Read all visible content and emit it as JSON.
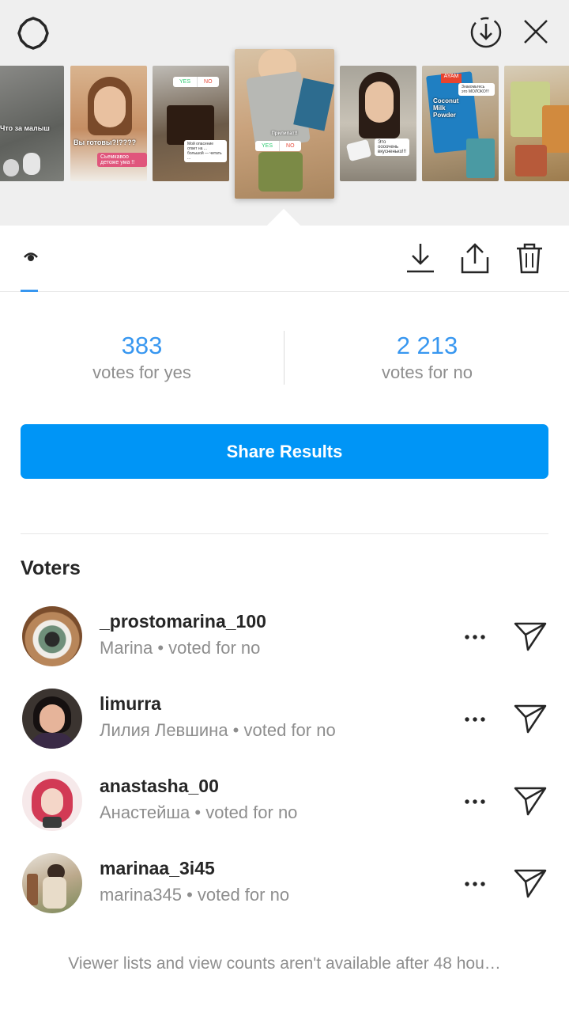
{
  "tray": {
    "thumbs": [
      {
        "caption": "Что за малыш"
      },
      {
        "caption": "Вы готовы?!????",
        "sub": "Сьемкавоо детоже ума !!"
      },
      {
        "caption": "",
        "poll_yes": "YES",
        "poll_no": "NO",
        "note": "Мой опасение ответ на ... большой — читать ..."
      },
      {
        "caption": "Прилипат!!",
        "poll_yes": "YES",
        "poll_no": "NO"
      },
      {
        "caption": "Это оооочень вкусненько!!!"
      },
      {
        "caption": "Coconut Milk Powder",
        "brand": "AYAM",
        "note": "Знакомьтесь это МОЛОКО!!!"
      },
      {
        "caption": ""
      }
    ]
  },
  "results": {
    "yes_count": "383",
    "yes_label": "votes for yes",
    "no_count": "2 213",
    "no_label": "votes for no"
  },
  "share_label": "Share Results",
  "voters_heading": "Voters",
  "voters": [
    {
      "username": "_prostomarina_100",
      "meta": "Marina • voted for no"
    },
    {
      "username": "limurra",
      "meta": "Лилия Левшина • voted for no"
    },
    {
      "username": "anastasha_00",
      "meta": "Анастейша • voted for no"
    },
    {
      "username": "marinaa_3i45",
      "meta": "marina345 • voted for no"
    }
  ],
  "footer_text": "Viewer lists and view counts aren't available after 48 hou…",
  "colors": {
    "accent": "#0095f6",
    "link": "#3897f0",
    "muted": "#8e8e8e"
  },
  "icons": {
    "settings": "gear-icon",
    "save": "download-circle-icon",
    "close": "close-icon",
    "views": "eye-icon",
    "download": "download-icon",
    "share": "share-icon",
    "delete": "trash-icon",
    "more": "more-dots-icon",
    "send": "send-icon"
  }
}
